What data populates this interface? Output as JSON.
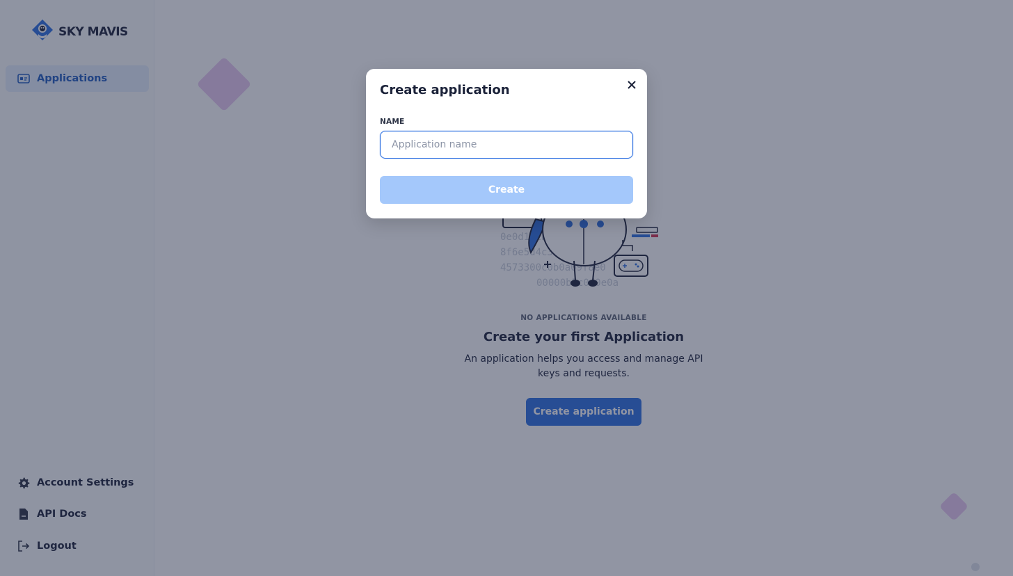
{
  "brand": {
    "name": "SKY MAVIS"
  },
  "sidebar": {
    "items": [
      {
        "label": "Applications",
        "icon": "id-card-icon",
        "active": true
      }
    ],
    "bottom_items": [
      {
        "label": "Account Settings",
        "icon": "gear-icon"
      },
      {
        "label": "API Docs",
        "icon": "document-icon"
      },
      {
        "label": "Logout",
        "icon": "logout-icon"
      }
    ]
  },
  "empty_state": {
    "kicker": "NO APPLICATIONS AVAILABLE",
    "title": "Create your first Application",
    "description": "An application helps you access and manage API keys and requests.",
    "cta_label": "Create application"
  },
  "modal": {
    "title": "Create application",
    "field_label": "NAME",
    "input_value": "",
    "input_placeholder": "Application name",
    "submit_label": "Create"
  },
  "colors": {
    "accent": "#2a6ee0",
    "accent_disabled": "#a4c8fb",
    "active_nav_bg": "#e4eefc",
    "overlay": "#242c48"
  }
}
